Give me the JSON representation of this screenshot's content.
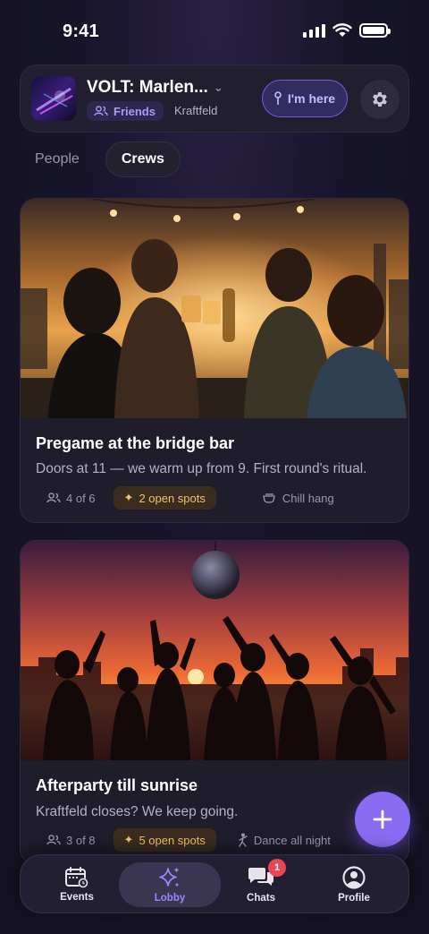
{
  "status_bar": {
    "time": "9:41"
  },
  "header": {
    "event_title": "VOLT: Marlen...",
    "group_badge": "Friends",
    "venue": "Kraftfeld",
    "im_here_label": "I'm here"
  },
  "tabs": [
    {
      "label": "People",
      "active": false
    },
    {
      "label": "Crews",
      "active": true
    }
  ],
  "crews": [
    {
      "title": "Pregame at the bridge bar",
      "description": "Doors at 11 — we warm up from 9. First round's ritual.",
      "members": "4 of 6",
      "open_spots": "2 open spots",
      "vibe": "Chill hang",
      "vibe_icon": "coffee-icon"
    },
    {
      "title": "Afterparty till sunrise",
      "description": "Kraftfeld closes? We keep going.",
      "members": "3 of 8",
      "open_spots": "5 open spots",
      "vibe": "Dance all night",
      "vibe_icon": "dancer-icon"
    }
  ],
  "fab": {
    "icon": "plus-icon"
  },
  "bottom_nav": [
    {
      "label": "Events",
      "icon": "calendar-icon",
      "active": false
    },
    {
      "label": "Lobby",
      "icon": "sparkle-icon",
      "active": true
    },
    {
      "label": "Chats",
      "icon": "chat-icon",
      "active": false,
      "badge": "1"
    },
    {
      "label": "Profile",
      "icon": "profile-icon",
      "active": false
    }
  ],
  "colors": {
    "accent": "#8a6cf3",
    "spots": "#f2c36b",
    "badge": "#ea4554"
  }
}
